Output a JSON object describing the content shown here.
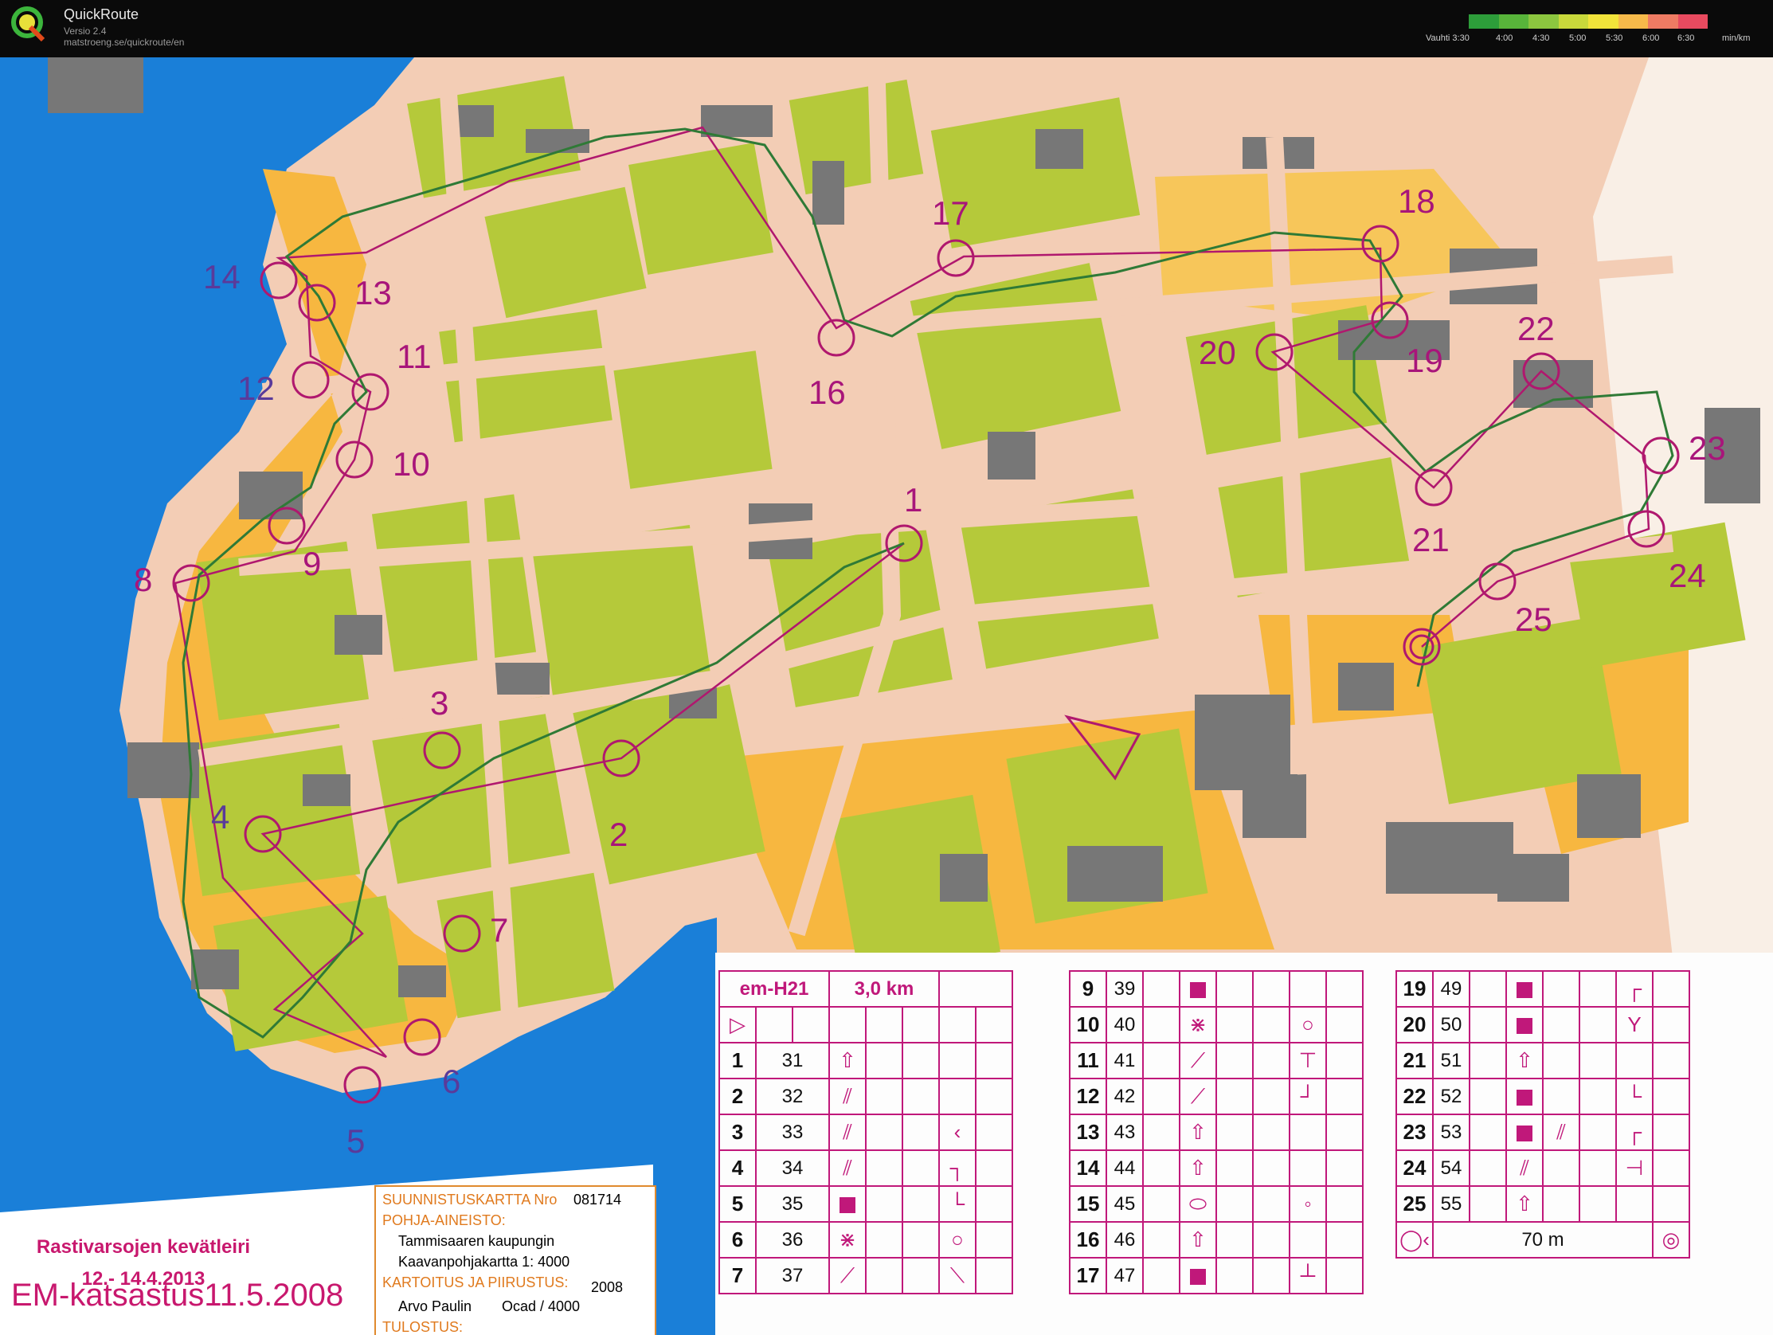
{
  "app": {
    "name": "QuickRoute",
    "version": "Versio 2.4",
    "url": "matstroeng.se/quickroute/en"
  },
  "pace_legend": {
    "unit": "min/km",
    "labels": [
      "Vauhti 3:30",
      "4:00",
      "4:30",
      "5:00",
      "5:30",
      "6:00",
      "6:30"
    ],
    "colors": [
      "#2d9d3a",
      "#58b43a",
      "#8cc63f",
      "#c8d83b",
      "#f1e33a",
      "#f6b94a",
      "#ee7b63",
      "#e84a5f"
    ]
  },
  "map": {
    "colors": {
      "water": "#1a7fd8",
      "paved": "#f3cdb5",
      "open": "#f7b740",
      "vegetation": "#b5c93a",
      "building": "#777777",
      "course": "#b0186e",
      "route": "#2f7a36"
    },
    "controls": [
      "1",
      "2",
      "3",
      "4",
      "5",
      "6",
      "7",
      "8",
      "9",
      "10",
      "11",
      "12",
      "13",
      "14",
      "16",
      "17",
      "18",
      "19",
      "20",
      "21",
      "22",
      "23",
      "24",
      "25"
    ],
    "event_title": "Rastivarsojen kevätleiri",
    "event_dates": "12.- 14.4.2013",
    "caption": "EM-katsastus11.5.2008",
    "info": {
      "line1_label": "SUUNNISTUSKARTTA Nro",
      "line1_value": "081714",
      "base_label": "POHJA-AINEISTO:",
      "base_line1": "Tammisaaren kaupungin",
      "base_line2": "Kaavanpohjakartta 1: 4000",
      "mapping_label": "KARTOITUS JA PIIRUSTUS:",
      "mapping_year": "2008",
      "mapper": "Arvo Paulin",
      "software": "Ocad / 4000",
      "print_label": "TULOSTUS:"
    }
  },
  "descriptions": {
    "course": "em-H21",
    "length": "3,0 km",
    "finish_distance": "70 m",
    "col1": [
      {
        "n": "1",
        "code": "31"
      },
      {
        "n": "2",
        "code": "32"
      },
      {
        "n": "3",
        "code": "33"
      },
      {
        "n": "4",
        "code": "34"
      },
      {
        "n": "5",
        "code": "35"
      },
      {
        "n": "6",
        "code": "36"
      },
      {
        "n": "7",
        "code": "37"
      }
    ],
    "col2": [
      {
        "n": "9",
        "code": "39"
      },
      {
        "n": "10",
        "code": "40"
      },
      {
        "n": "11",
        "code": "41"
      },
      {
        "n": "12",
        "code": "42"
      },
      {
        "n": "13",
        "code": "43"
      },
      {
        "n": "14",
        "code": "44"
      },
      {
        "n": "15",
        "code": "45"
      },
      {
        "n": "16",
        "code": "46"
      },
      {
        "n": "17",
        "code": "47"
      }
    ],
    "col3": [
      {
        "n": "19",
        "code": "49"
      },
      {
        "n": "20",
        "code": "50"
      },
      {
        "n": "21",
        "code": "51"
      },
      {
        "n": "22",
        "code": "52"
      },
      {
        "n": "23",
        "code": "53"
      },
      {
        "n": "24",
        "code": "54"
      },
      {
        "n": "25",
        "code": "55"
      }
    ]
  }
}
